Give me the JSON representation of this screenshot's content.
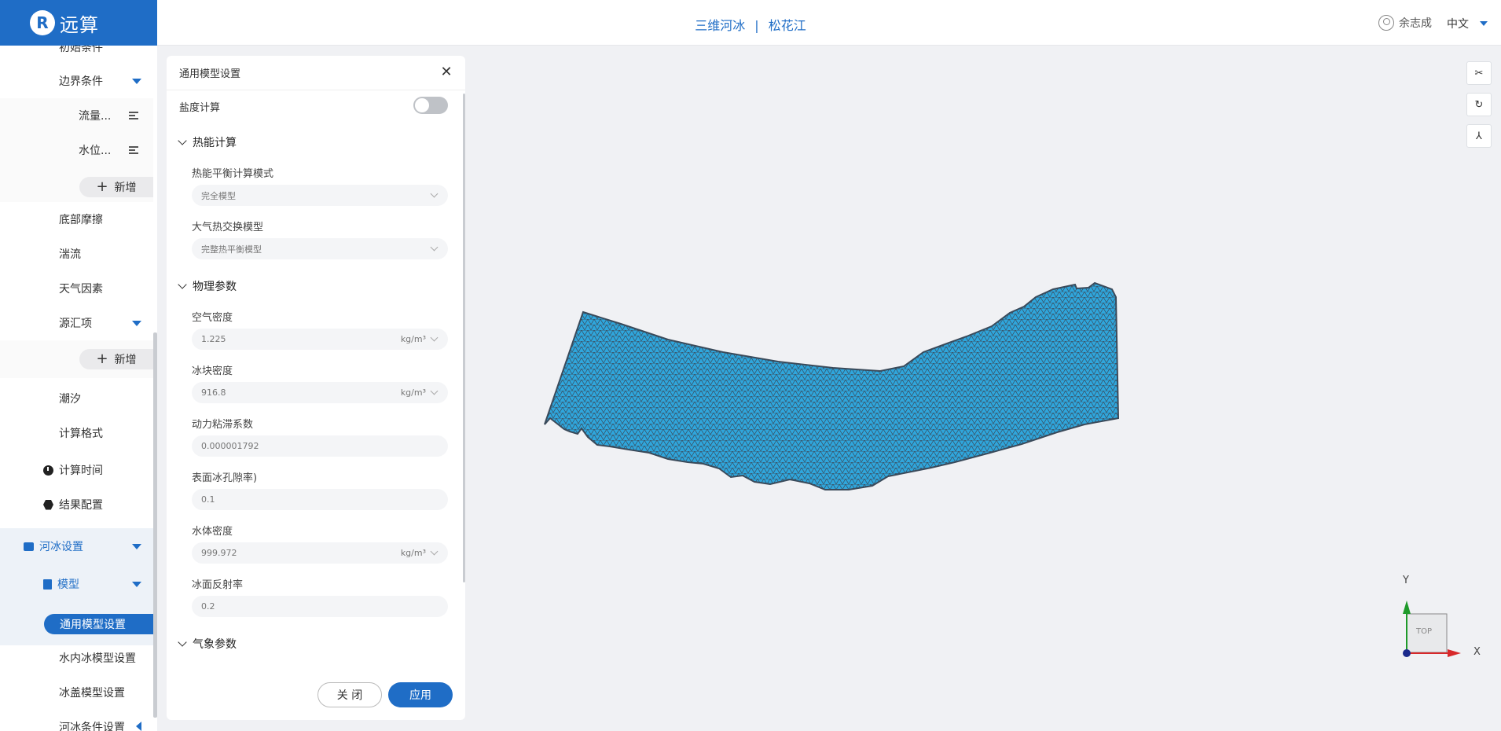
{
  "header": {
    "logo_mark": "R",
    "logo_text": "远算",
    "project_type": "三维河冰",
    "separator": "|",
    "project_name": "松花江",
    "user_name": "余志成",
    "language": "中文"
  },
  "sidebar": {
    "items": [
      {
        "label": "初始条件"
      },
      {
        "label": "边界条件"
      },
      {
        "label": "流量..."
      },
      {
        "label": "水位..."
      },
      {
        "label": "新增"
      },
      {
        "label": "底部摩擦"
      },
      {
        "label": "湍流"
      },
      {
        "label": "天气因素"
      },
      {
        "label": "源汇项"
      },
      {
        "label": "新增"
      },
      {
        "label": "潮汐"
      },
      {
        "label": "计算格式"
      },
      {
        "label": "计算时间"
      },
      {
        "label": "结果配置"
      },
      {
        "label": "河冰设置"
      },
      {
        "label": "模型"
      },
      {
        "label": "通用模型设置"
      },
      {
        "label": "水内冰模型设置"
      },
      {
        "label": "冰盖模型设置"
      },
      {
        "label": "河冰条件设置"
      }
    ]
  },
  "panel": {
    "title": "通用模型设置",
    "salinity_label": "盐度计算",
    "salinity_enabled": false,
    "thermal": {
      "group": "热能计算",
      "balance_label": "热能平衡计算模式",
      "balance_value": "完全模型",
      "exchange_label": "大气热交换模型",
      "exchange_value": "完整热平衡模型"
    },
    "physics": {
      "group": "物理参数",
      "air_density_label": "空气密度",
      "air_density_value": "1.225",
      "ice_density_label": "冰块密度",
      "ice_density_value": "916.8",
      "viscosity_label": "动力粘滞系数",
      "viscosity_value": "0.000001792",
      "porosity_label": "表面冰孔隙率)",
      "porosity_value": "0.1",
      "water_density_label": "水体密度",
      "water_density_value": "999.972",
      "albedo_label": "冰面反射率",
      "albedo_value": "0.2",
      "density_unit": "kg/m³"
    },
    "weather_group": "气象参数",
    "close_label": "关 闭",
    "apply_label": "应用"
  },
  "viewport": {
    "view_label": "TOP",
    "axis_x": "X",
    "axis_y": "Y",
    "mesh_color": "#2fa6dc",
    "mesh_edge_color": "#3a4a5a"
  }
}
